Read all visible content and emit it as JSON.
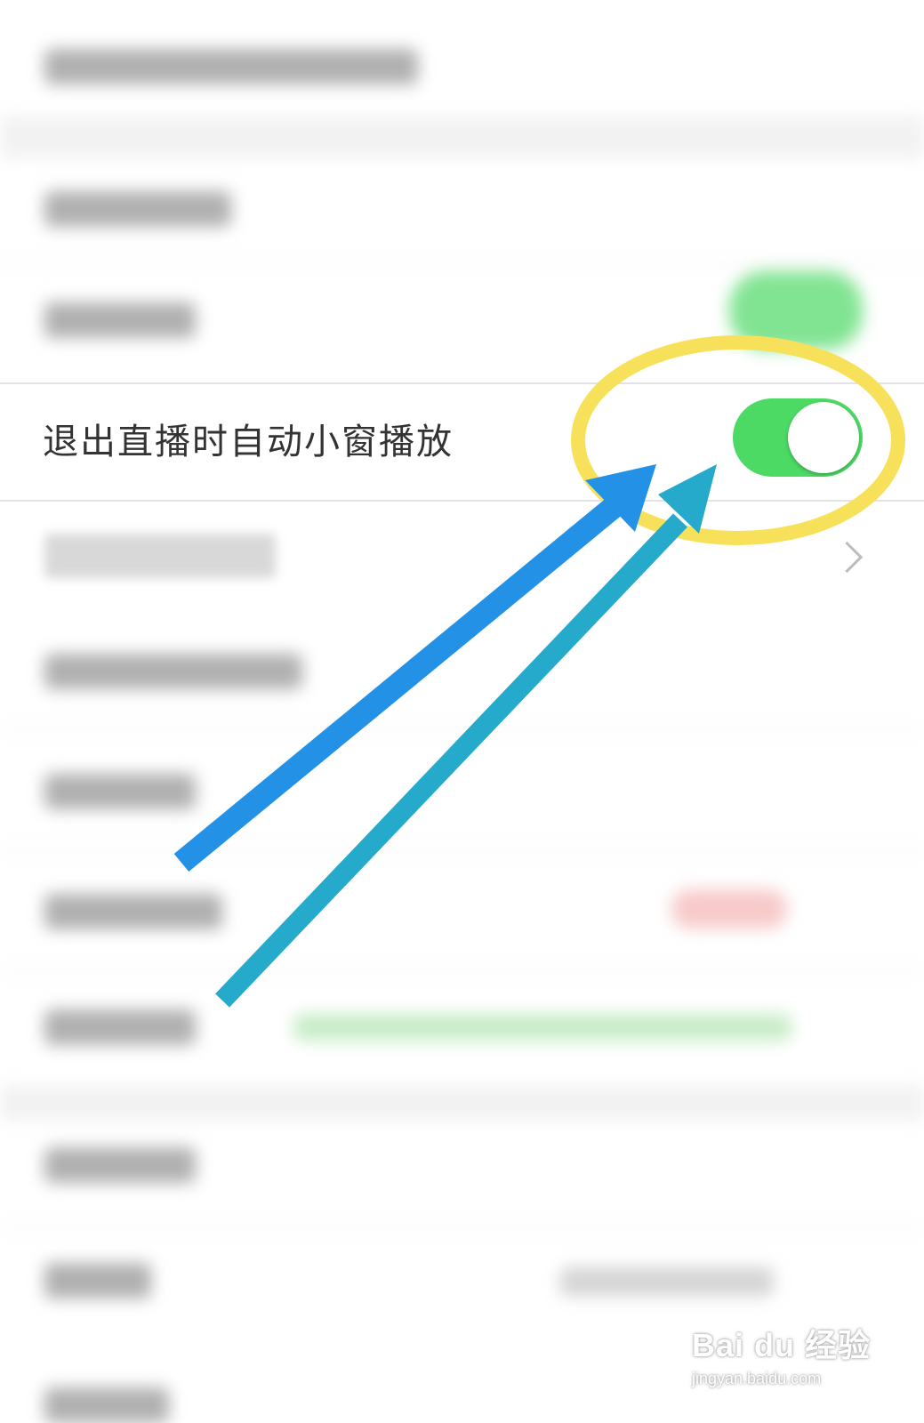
{
  "setting_row": {
    "label": "退出直播时自动小窗播放",
    "toggle_on": true,
    "toggle_color": "#4cd964"
  },
  "annotations": {
    "highlight_color": "#f8e15a",
    "arrow_color_1": "#2291e6",
    "arrow_color_2": "#25aacb"
  },
  "watermark": {
    "main": "Bai du 经验",
    "sub": "jingyan.baidu.com"
  }
}
